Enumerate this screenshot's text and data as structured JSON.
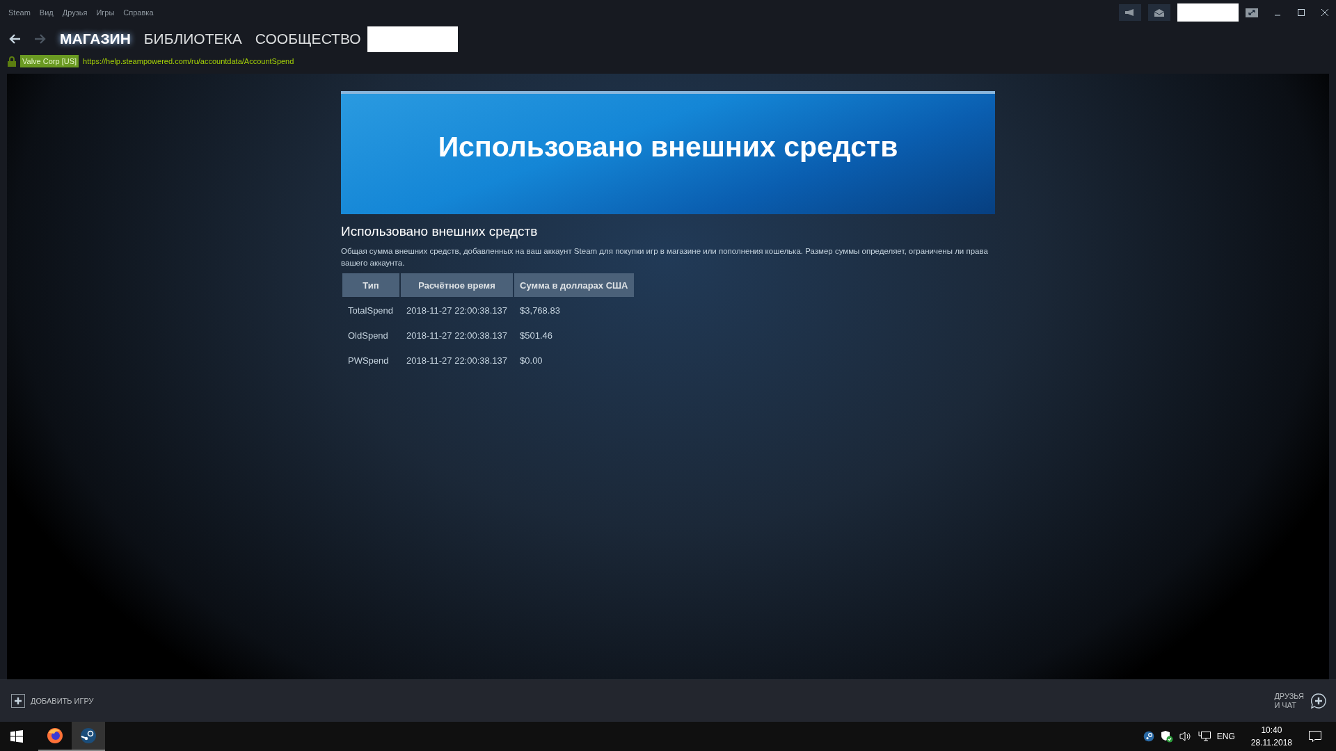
{
  "menu": [
    "Steam",
    "Вид",
    "Друзья",
    "Игры",
    "Справка"
  ],
  "nav": {
    "back_enabled": true,
    "forward_enabled": false,
    "tabs": [
      {
        "label": "МАГАЗИН",
        "selected": true
      },
      {
        "label": "БИБЛИОТЕКА",
        "selected": false
      },
      {
        "label": "СООБЩЕСТВО",
        "selected": false
      }
    ]
  },
  "address": {
    "certificate": "Valve Corp [US]",
    "url": "https://help.steampowered.com/ru/accountdata/AccountSpend"
  },
  "page": {
    "banner_title": "Использовано внешних средств",
    "heading": "Использовано внешних средств",
    "description": "Общая сумма внешних средств, добавленных на ваш аккаунт Steam для покупки игр в магазине или пополнения кошелька. Размер суммы определяет, ограничены ли права вашего аккаунта.",
    "table": {
      "columns": [
        "Тип",
        "Расчётное время",
        "Сумма в долларах США"
      ],
      "rows": [
        [
          "TotalSpend",
          "2018-11-27 22:00:38.137",
          "$3,768.83"
        ],
        [
          "OldSpend",
          "2018-11-27 22:00:38.137",
          "$501.46"
        ],
        [
          "PWSpend",
          "2018-11-27 22:00:38.137",
          "$0.00"
        ]
      ]
    }
  },
  "bottom_bar": {
    "add_game": "ДОБАВИТЬ ИГРУ",
    "friends_chat": [
      "ДРУЗЬЯ",
      "И ЧАТ"
    ]
  },
  "taskbar": {
    "apps": [
      {
        "kind": "firefox",
        "selected": false
      },
      {
        "kind": "steam",
        "selected": true
      }
    ],
    "language": "ENG",
    "time": "10:40",
    "date": "28.11.2018"
  }
}
